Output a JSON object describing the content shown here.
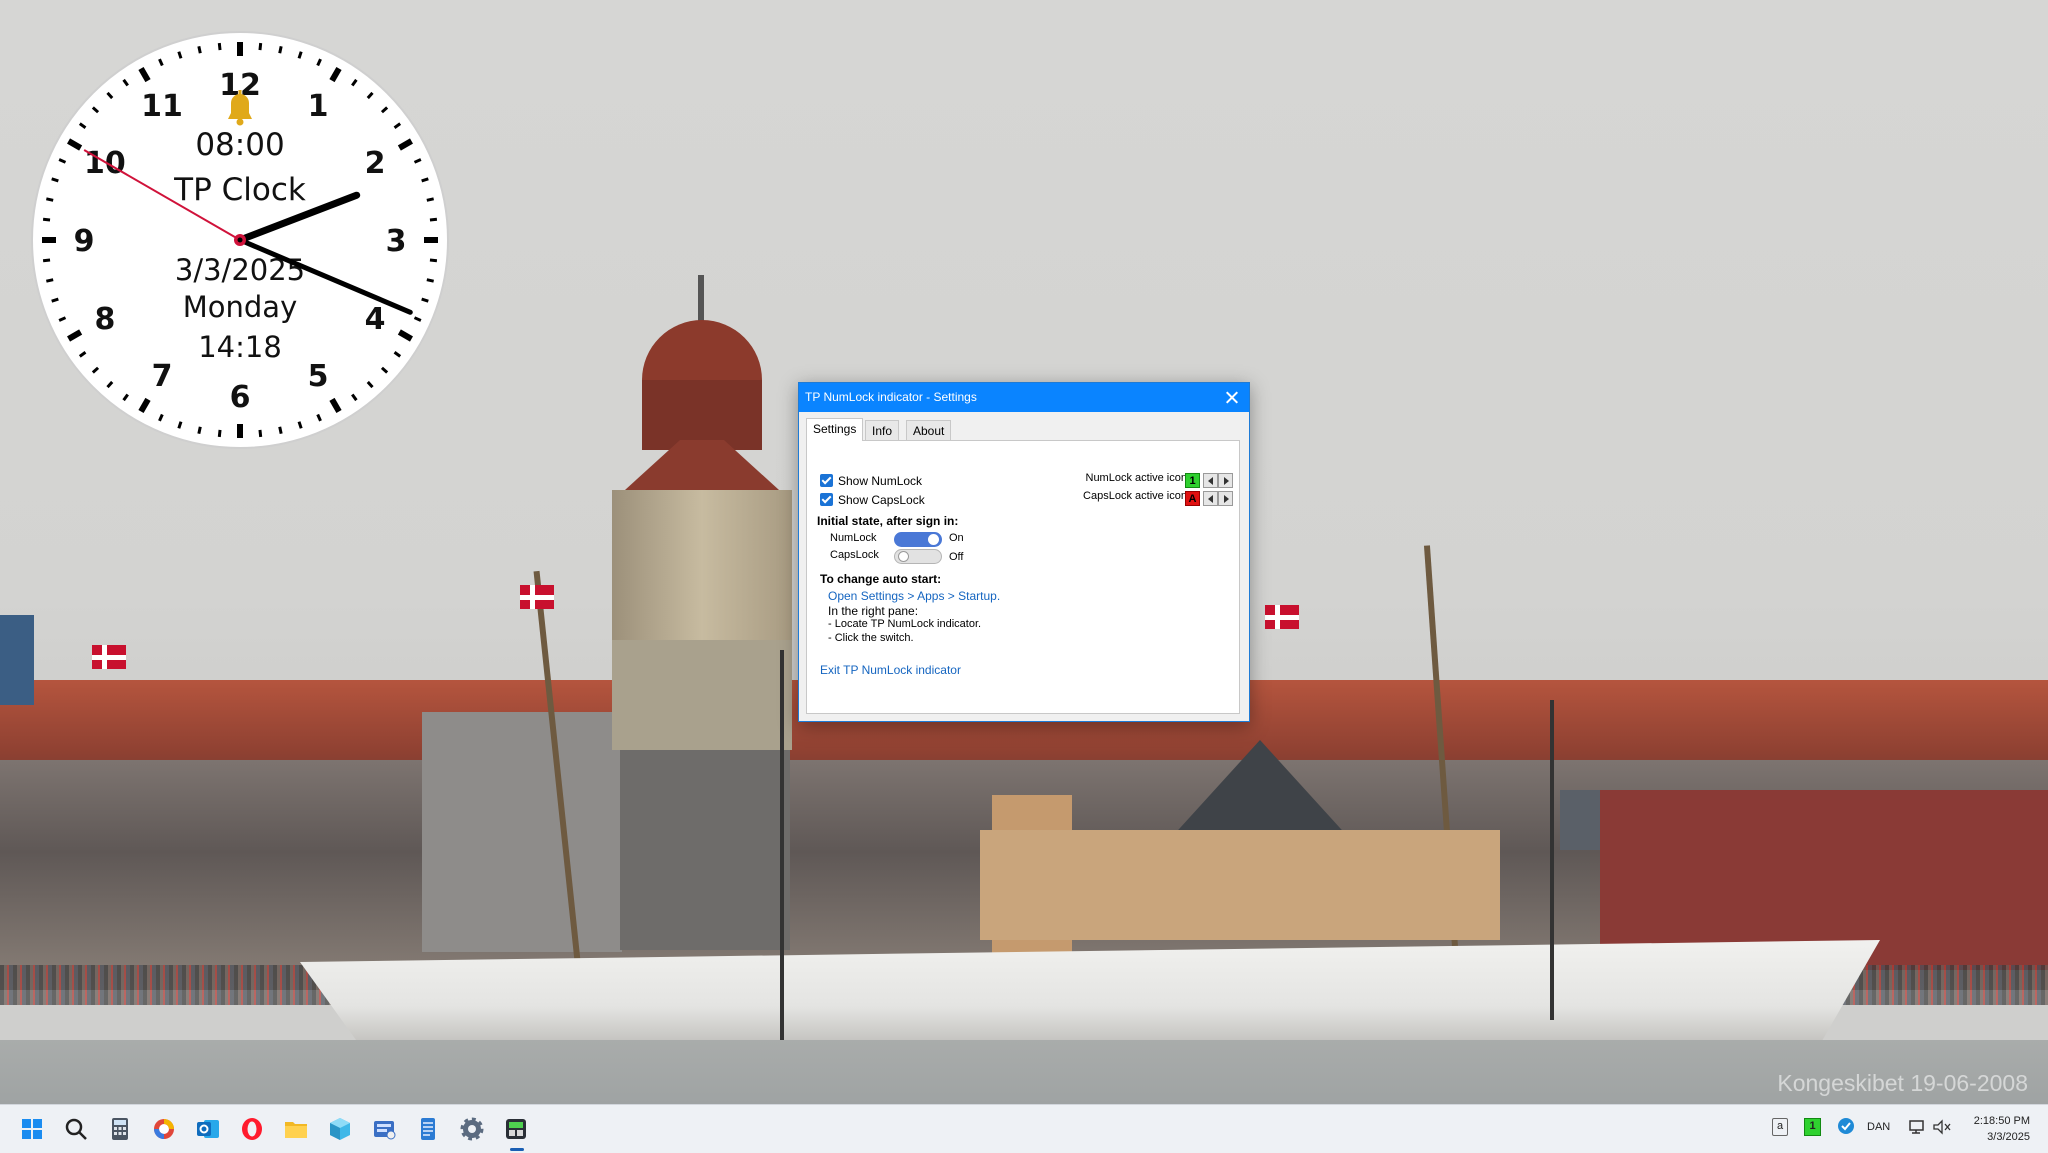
{
  "wallpaper": {
    "watermark": "Kongeskibet 19-06-2008"
  },
  "clock": {
    "numerals": [
      "12",
      "1",
      "2",
      "3",
      "4",
      "5",
      "6",
      "7",
      "8",
      "9",
      "10",
      "11"
    ],
    "alarm_time": "08:00",
    "title": "TP Clock",
    "date": "3/3/2025",
    "weekday": "Monday",
    "digital_time": "14:18",
    "hands": {
      "hour": 2,
      "minute": 18,
      "second": 50
    },
    "colors": {
      "second_hand": "#d0123a",
      "bell": "#e0a91a"
    },
    "bell_icon": "bell-icon"
  },
  "dialog": {
    "title": "TP NumLock indicator - Settings",
    "tabs": [
      {
        "label": "Settings",
        "active": true
      },
      {
        "label": "Info",
        "active": false
      },
      {
        "label": "About",
        "active": false
      }
    ],
    "settings": {
      "show_numlock": {
        "label": "Show NumLock",
        "checked": true
      },
      "show_capslock": {
        "label": "Show CapsLock",
        "checked": true
      },
      "numlock_icon_label": "NumLock active icon",
      "numlock_icon_glyph": "1",
      "capslock_icon_label": "CapsLock active icon",
      "capslock_icon_glyph": "A",
      "initial_state_heading": "Initial state, after sign in:",
      "numlock_toggle": {
        "label": "NumLock",
        "state": "On"
      },
      "capslock_toggle": {
        "label": "CapsLock",
        "state": "Off"
      },
      "autostart_heading": "To change auto start:",
      "open_settings": "Open Settings",
      "sep1": ">",
      "apps": "Apps",
      "sep2": ">",
      "startup": "Startup.",
      "right_pane": "In the right pane:",
      "step1": "- Locate TP NumLock indicator.",
      "step2": "- Click the switch.",
      "exit_link": "Exit TP NumLock indicator"
    },
    "colors": {
      "accent": "#0a84ff",
      "numlock_icon": "#2fd12f",
      "capslock_icon": "#e01010"
    }
  },
  "taskbar": {
    "icons": [
      "windows-start-icon",
      "search-icon",
      "calculator-icon",
      "browser-icon",
      "outlook-icon",
      "opera-icon",
      "file-explorer-icon",
      "cube-app-icon",
      "editor-app-icon",
      "notepad-icon",
      "settings-gear-icon",
      "tp-app-icon"
    ],
    "tray": {
      "keyboard_glyph": "a",
      "numlock_glyph": "1",
      "language": "DAN",
      "time": "2:18:50 PM",
      "date": "3/3/2025"
    }
  }
}
